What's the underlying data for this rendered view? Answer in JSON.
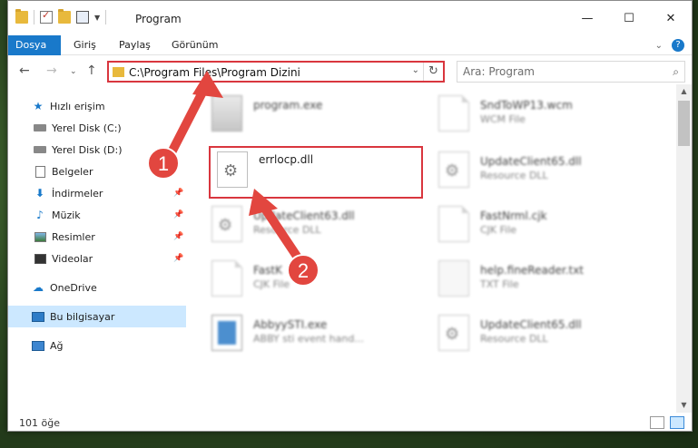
{
  "window": {
    "title": "Program"
  },
  "ribbon": {
    "tabs": [
      "Dosya",
      "Giriş",
      "Paylaş",
      "Görünüm"
    ]
  },
  "address": {
    "path": "C:\\Program Files\\Program Dizini"
  },
  "search": {
    "placeholder": "Ara: Program"
  },
  "sidebar": {
    "items": [
      {
        "label": "Hızlı erişim",
        "icon": "star-icon"
      },
      {
        "label": "Yerel Disk (C:)",
        "icon": "disk-icon"
      },
      {
        "label": "Yerel Disk (D:)",
        "icon": "disk-icon"
      },
      {
        "label": "Belgeler",
        "icon": "document-icon"
      },
      {
        "label": "İndirmeler",
        "icon": "download-icon"
      },
      {
        "label": "Müzik",
        "icon": "music-icon"
      },
      {
        "label": "Resimler",
        "icon": "pictures-icon"
      },
      {
        "label": "Videolar",
        "icon": "video-icon"
      },
      {
        "label": "OneDrive",
        "icon": "cloud-icon"
      },
      {
        "label": "Bu bilgisayar",
        "icon": "computer-icon"
      },
      {
        "label": "Ağ",
        "icon": "network-icon"
      }
    ]
  },
  "files": [
    {
      "name": "program.exe",
      "type": ""
    },
    {
      "name": "SndToWP13.wcm",
      "type": "WCM File"
    },
    {
      "name": "errlocp.dll",
      "type": ""
    },
    {
      "name": "UpdateClient65.dll",
      "type": "Resource DLL"
    },
    {
      "name": "UpdateClient63.dll",
      "type": "Resource DLL"
    },
    {
      "name": "FastNrml.cjk",
      "type": "CJK File"
    },
    {
      "name": "FastK",
      "type": "CJK File"
    },
    {
      "name": "help.fineReader.txt",
      "type": "TXT File"
    },
    {
      "name": "AbbyySTI.exe",
      "type": "ABBY sti event hand..."
    },
    {
      "name": "UpdateClient65.dll",
      "type": "Resource DLL"
    }
  ],
  "status": {
    "count": "101 öğe"
  },
  "annotations": {
    "step1": "1",
    "step2": "2"
  },
  "colors": {
    "accent": "#1979ca",
    "highlight": "#d9363e"
  }
}
